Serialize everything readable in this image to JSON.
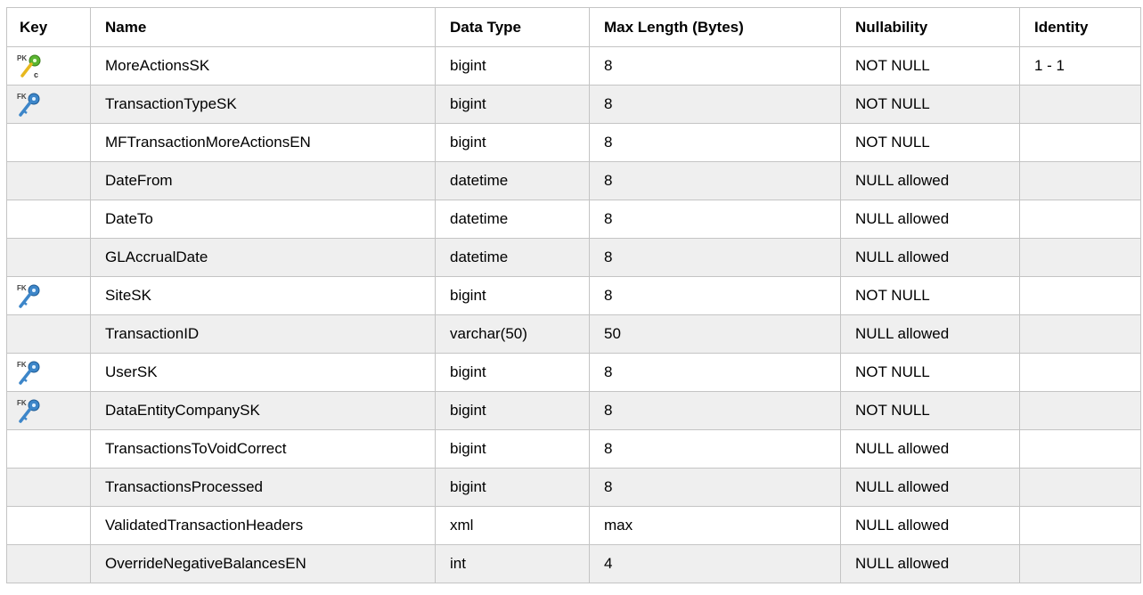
{
  "headers": {
    "key": "Key",
    "name": "Name",
    "data_type": "Data Type",
    "max_length": "Max Length (Bytes)",
    "nullability": "Nullability",
    "identity": "Identity"
  },
  "rows": [
    {
      "key_icon": "primary-foreign-key-clustered-icon",
      "name": "MoreActionsSK",
      "data_type": "bigint",
      "max_length": "8",
      "nullability": "NOT NULL",
      "identity": "1 - 1"
    },
    {
      "key_icon": "foreign-key-icon",
      "name": "TransactionTypeSK",
      "data_type": "bigint",
      "max_length": "8",
      "nullability": "NOT NULL",
      "identity": ""
    },
    {
      "key_icon": "",
      "name": "MFTransactionMoreActionsEN",
      "data_type": "bigint",
      "max_length": "8",
      "nullability": "NOT NULL",
      "identity": ""
    },
    {
      "key_icon": "",
      "name": "DateFrom",
      "data_type": "datetime",
      "max_length": "8",
      "nullability": "NULL allowed",
      "identity": ""
    },
    {
      "key_icon": "",
      "name": "DateTo",
      "data_type": "datetime",
      "max_length": "8",
      "nullability": "NULL allowed",
      "identity": ""
    },
    {
      "key_icon": "",
      "name": "GLAccrualDate",
      "data_type": "datetime",
      "max_length": "8",
      "nullability": "NULL allowed",
      "identity": ""
    },
    {
      "key_icon": "foreign-key-icon",
      "name": "SiteSK",
      "data_type": "bigint",
      "max_length": "8",
      "nullability": "NOT NULL",
      "identity": ""
    },
    {
      "key_icon": "",
      "name": "TransactionID",
      "data_type": "varchar(50)",
      "max_length": "50",
      "nullability": "NULL allowed",
      "identity": ""
    },
    {
      "key_icon": "foreign-key-icon",
      "name": "UserSK",
      "data_type": "bigint",
      "max_length": "8",
      "nullability": "NOT NULL",
      "identity": ""
    },
    {
      "key_icon": "foreign-key-icon",
      "name": "DataEntityCompanySK",
      "data_type": "bigint",
      "max_length": "8",
      "nullability": "NOT NULL",
      "identity": ""
    },
    {
      "key_icon": "",
      "name": "TransactionsToVoidCorrect",
      "data_type": "bigint",
      "max_length": "8",
      "nullability": "NULL allowed",
      "identity": ""
    },
    {
      "key_icon": "",
      "name": "TransactionsProcessed",
      "data_type": "bigint",
      "max_length": "8",
      "nullability": "NULL allowed",
      "identity": ""
    },
    {
      "key_icon": "",
      "name": "ValidatedTransactionHeaders",
      "data_type": "xml",
      "max_length": "max",
      "nullability": "NULL allowed",
      "identity": ""
    },
    {
      "key_icon": "",
      "name": "OverrideNegativeBalancesEN",
      "data_type": "int",
      "max_length": "4",
      "nullability": "NULL allowed",
      "identity": ""
    }
  ],
  "colors": {
    "fk_key_blue": "#3d86c9",
    "pk_key_green": "#5bb531",
    "pk_key_yellow": "#e7b81e",
    "alt_row_bg": "#efefef",
    "grid_line": "#c4c4c4"
  }
}
